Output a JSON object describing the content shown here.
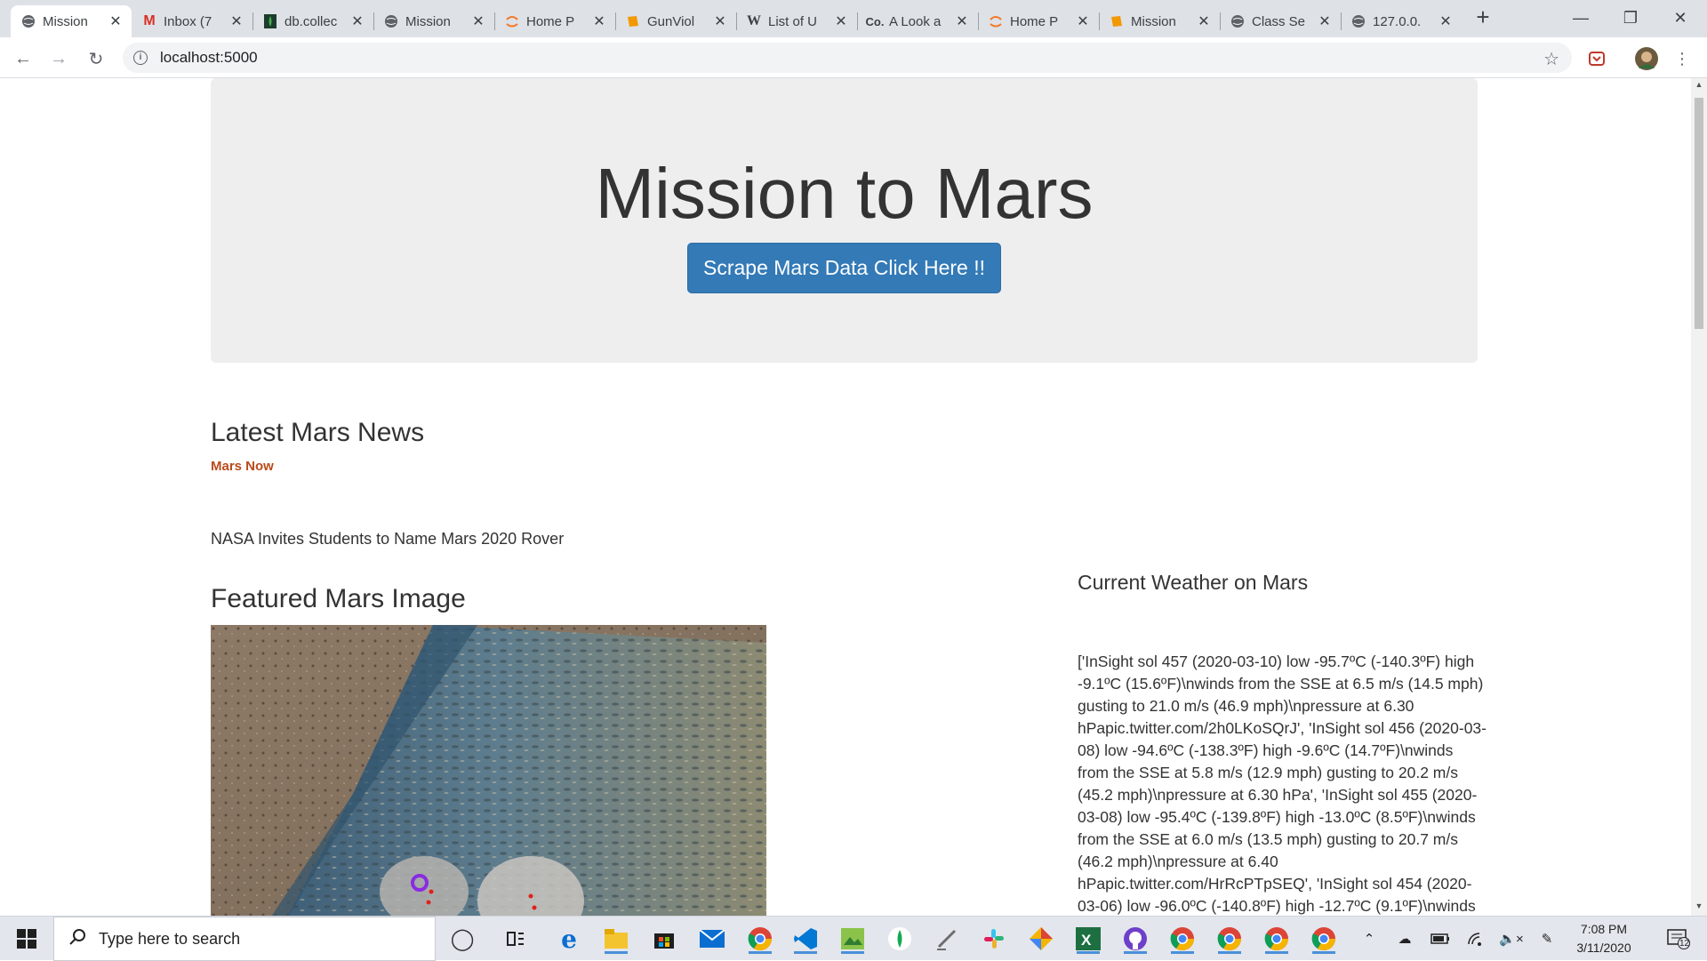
{
  "browser": {
    "tabs": [
      {
        "title": "Mission",
        "icon": "globe-icon",
        "active": true
      },
      {
        "title": "Inbox (7",
        "icon": "gmail-icon"
      },
      {
        "title": "db.collec",
        "icon": "mongodb-icon"
      },
      {
        "title": "Mission",
        "icon": "globe-icon"
      },
      {
        "title": "Home P",
        "icon": "jupyter-icon"
      },
      {
        "title": "GunViol",
        "icon": "book-icon"
      },
      {
        "title": "List of U",
        "icon": "wikipedia-icon"
      },
      {
        "title": "A Look a",
        "icon": "co-icon"
      },
      {
        "title": "Home P",
        "icon": "jupyter-icon"
      },
      {
        "title": "Mission",
        "icon": "book-icon"
      },
      {
        "title": "Class Se",
        "icon": "globe-icon"
      },
      {
        "title": "127.0.0.",
        "icon": "globe-icon"
      }
    ],
    "url": "localhost:5000"
  },
  "page": {
    "title": "Mission to Mars",
    "scrape_button": "Scrape Mars Data Click Here !!",
    "news_heading": "Latest Mars News",
    "news_link": "Mars Now",
    "news_title": "NASA Invites Students to Name Mars 2020 Rover",
    "image_heading": "Featured Mars Image",
    "weather_heading": "Current Weather on Mars",
    "weather_text": "['InSight sol 457 (2020-03-10) low -95.7ºC (-140.3ºF) high -9.1ºC (15.6ºF)\\nwinds from the SSE at 6.5 m/s (14.5 mph) gusting to 21.0 m/s (46.9 mph)\\npressure at 6.30 hPapic.twitter.com/2h0LKoSQrJ', 'InSight sol 456 (2020-03-08) low -94.6ºC (-138.3ºF) high -9.6ºC (14.7ºF)\\nwinds from the SSE at 5.8 m/s (12.9 mph) gusting to 20.2 m/s (45.2 mph)\\npressure at 6.30 hPa', 'InSight sol 455 (2020-03-08) low -95.4ºC (-139.8ºF) high -13.0ºC (8.5ºF)\\nwinds from the SSE at 6.0 m/s (13.5 mph) gusting to 20.7 m/s (46.2 mph)\\npressure at 6.40 hPapic.twitter.com/HrRcPTpSEQ', 'InSight sol 454 (2020-03-06) low -96.0ºC (-140.8ºF) high -12.7ºC (9.1ºF)\\nwinds"
  },
  "taskbar": {
    "search_placeholder": "Type here to search",
    "time": "7:08 PM",
    "date": "3/11/2020",
    "notifications": "12"
  }
}
